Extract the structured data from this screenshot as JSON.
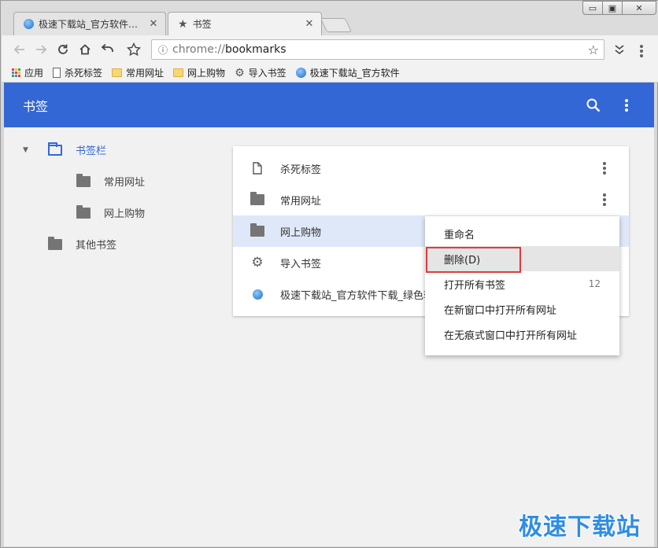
{
  "window": {
    "tabs": [
      {
        "title": "极速下载站_官方软件下载",
        "close": "✕"
      },
      {
        "title": "书签",
        "close": "✕"
      }
    ],
    "controls": {
      "minimize": "▭",
      "maximize": "▣",
      "close": "✕"
    }
  },
  "toolbar": {
    "url_scheme": "chrome://",
    "url_path": "bookmarks",
    "icons": [
      "back-arrow-icon",
      "forward-arrow-icon",
      "reload-icon",
      "home-icon",
      "undo-icon",
      "star-icon",
      "info-icon",
      "overflow-chevron-icon",
      "menu-dots-icon"
    ]
  },
  "bookmarks_bar": {
    "items": [
      {
        "label": "应用",
        "icon": "apps-grid-icon"
      },
      {
        "label": "杀死标签",
        "icon": "page-icon"
      },
      {
        "label": "常用网址",
        "icon": "folder-icon"
      },
      {
        "label": "网上购物",
        "icon": "folder-icon"
      },
      {
        "label": "导入书签",
        "icon": "gear-icon"
      },
      {
        "label": "极速下载站_官方软件",
        "icon": "globe-icon"
      }
    ]
  },
  "app": {
    "title": "书签",
    "accent": "#3367d6"
  },
  "sidebar": {
    "items": [
      {
        "label": "书签栏",
        "expanded": true,
        "selected": true
      },
      {
        "label": "常用网址"
      },
      {
        "label": "网上购物"
      },
      {
        "label": "其他书签"
      }
    ]
  },
  "list": {
    "rows": [
      {
        "label": "杀死标签",
        "icon": "page-icon"
      },
      {
        "label": "常用网址",
        "icon": "folder-icon"
      },
      {
        "label": "网上购物",
        "icon": "folder-icon",
        "selected": true
      },
      {
        "label": "导入书签",
        "icon": "gear-icon"
      },
      {
        "label": "极速下载站_官方软件下载_绿色软",
        "icon": "globe-icon"
      }
    ]
  },
  "context_menu": {
    "items": [
      {
        "label": "重命名"
      },
      {
        "label": "删除(D)",
        "highlighted": true
      },
      {
        "label": "打开所有书签",
        "count": "12"
      },
      {
        "label": "在新窗口中打开所有网址"
      },
      {
        "label": "在无痕式窗口中打开所有网址"
      }
    ],
    "highlight_color": "#e03b3b"
  },
  "watermark": "极速下载站"
}
